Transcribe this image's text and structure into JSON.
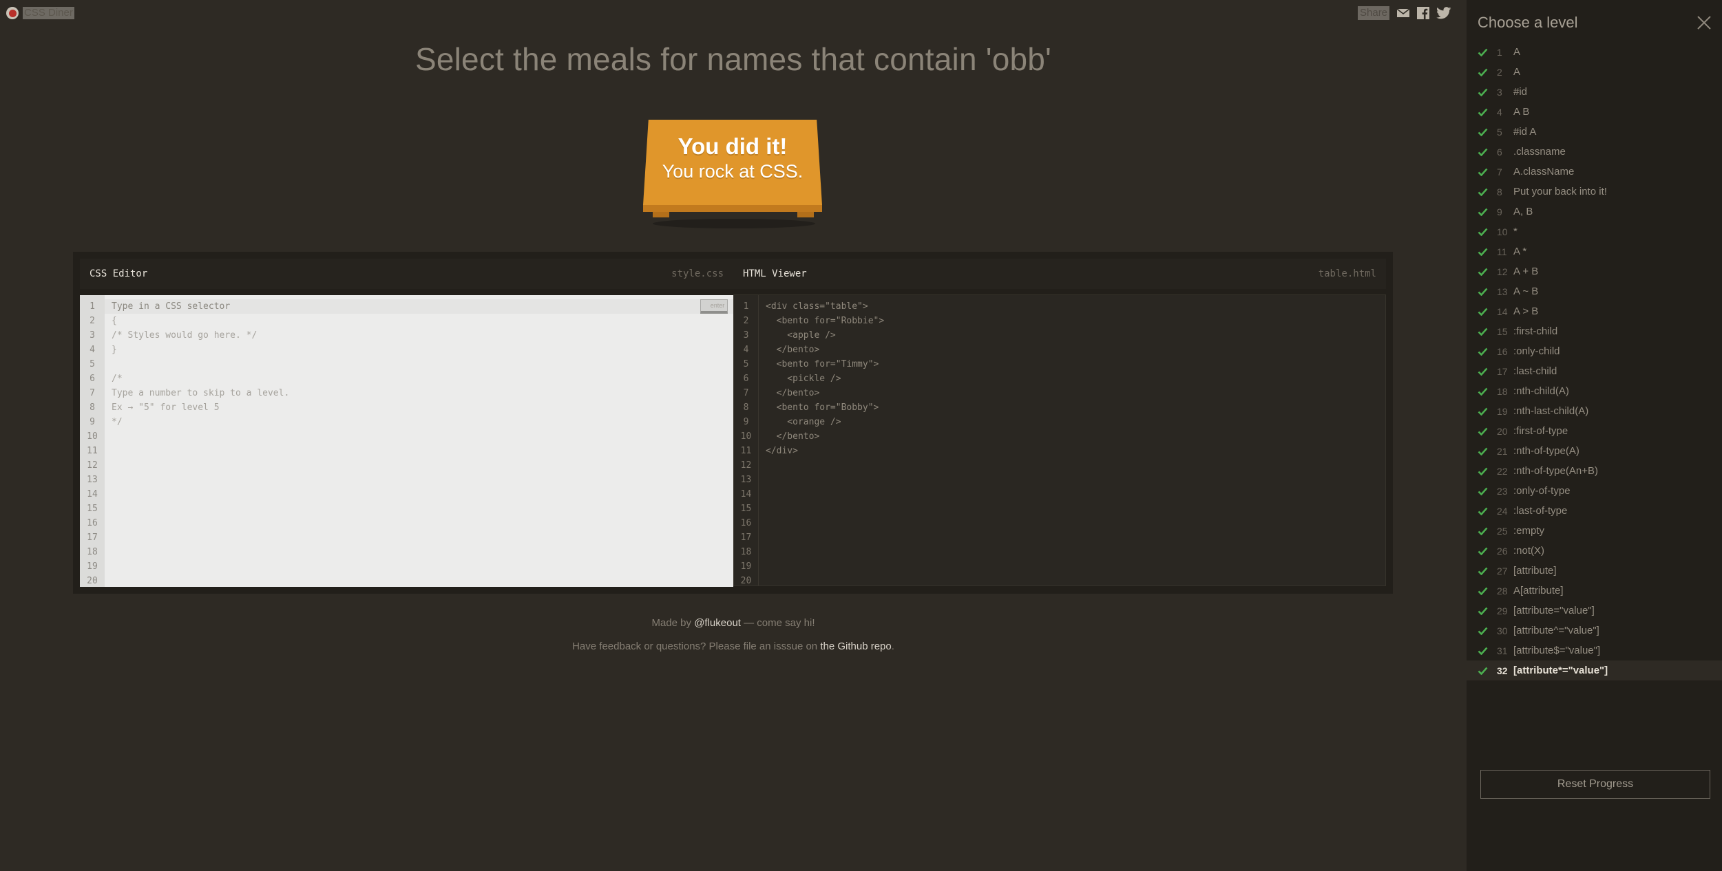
{
  "app": {
    "logo_text": "CSS Diner"
  },
  "share": {
    "label": "Share"
  },
  "heading": "Select the meals for names that contain 'obb'",
  "success": {
    "line1": "You did it!",
    "line2": "You rock at CSS."
  },
  "css_editor": {
    "title": "CSS Editor",
    "filename": "style.css",
    "enter_label": "enter",
    "line_numbers": [
      "1",
      "2",
      "3",
      "4",
      "5",
      "6",
      "7",
      "8",
      "9",
      "10",
      "11",
      "12",
      "13",
      "14",
      "15",
      "16",
      "17",
      "18",
      "19",
      "20"
    ],
    "lines": [
      "Type in a CSS selector",
      "{",
      "/* Styles would go here. */",
      "}",
      "",
      "/*",
      "Type a number to skip to a level.",
      "Ex → \"5\" for level 5",
      "*/"
    ]
  },
  "html_viewer": {
    "title": "HTML Viewer",
    "filename": "table.html",
    "line_numbers": [
      "1",
      "2",
      "3",
      "4",
      "5",
      "6",
      "7",
      "8",
      "9",
      "10",
      "11",
      "12",
      "13",
      "14",
      "15",
      "16",
      "17",
      "18",
      "19",
      "20"
    ],
    "lines": [
      "<div class=\"table\">",
      "  <bento for=\"Robbie\">",
      "    <apple />",
      "  </bento>",
      "  <bento for=\"Timmy\">",
      "    <pickle />",
      "  </bento>",
      "  <bento for=\"Bobby\">",
      "    <orange />",
      "  </bento>",
      "</div>"
    ]
  },
  "footer": {
    "line1_prefix": "Made by ",
    "line1_link": "@flukeout",
    "line1_suffix": " — come say hi!",
    "line2_prefix": "Have feedback or questions? Please file an isssue on ",
    "line2_link": "the Github repo",
    "line2_suffix": "."
  },
  "sidebar": {
    "title": "Choose a level",
    "reset_label": "Reset Progress",
    "levels": [
      {
        "num": "1",
        "label": "A"
      },
      {
        "num": "2",
        "label": "A"
      },
      {
        "num": "3",
        "label": "#id"
      },
      {
        "num": "4",
        "label": "A  B"
      },
      {
        "num": "5",
        "label": "#id  A"
      },
      {
        "num": "6",
        "label": ".classname"
      },
      {
        "num": "7",
        "label": "A.className"
      },
      {
        "num": "8",
        "label": "Put your back into it!"
      },
      {
        "num": "9",
        "label": "A, B"
      },
      {
        "num": "10",
        "label": "*"
      },
      {
        "num": "11",
        "label": "A  *"
      },
      {
        "num": "12",
        "label": "A + B"
      },
      {
        "num": "13",
        "label": "A ~ B"
      },
      {
        "num": "14",
        "label": "A > B"
      },
      {
        "num": "15",
        "label": ":first-child"
      },
      {
        "num": "16",
        "label": ":only-child"
      },
      {
        "num": "17",
        "label": ":last-child"
      },
      {
        "num": "18",
        "label": ":nth-child(A)"
      },
      {
        "num": "19",
        "label": ":nth-last-child(A)"
      },
      {
        "num": "20",
        "label": ":first-of-type"
      },
      {
        "num": "21",
        "label": ":nth-of-type(A)"
      },
      {
        "num": "22",
        "label": ":nth-of-type(An+B)"
      },
      {
        "num": "23",
        "label": ":only-of-type"
      },
      {
        "num": "24",
        "label": ":last-of-type"
      },
      {
        "num": "25",
        "label": ":empty"
      },
      {
        "num": "26",
        "label": ":not(X)"
      },
      {
        "num": "27",
        "label": "[attribute]"
      },
      {
        "num": "28",
        "label": "A[attribute]"
      },
      {
        "num": "29",
        "label": "[attribute=\"value\"]"
      },
      {
        "num": "30",
        "label": "[attribute^=\"value\"]"
      },
      {
        "num": "31",
        "label": "[attribute$=\"value\"]"
      },
      {
        "num": "32",
        "label": "[attribute*=\"value\"]"
      }
    ],
    "current_level": "32"
  },
  "colors": {
    "background": "#2e2a24",
    "sidebar": "#221f1a",
    "table": "#e0962b",
    "check": "#4caf50"
  }
}
